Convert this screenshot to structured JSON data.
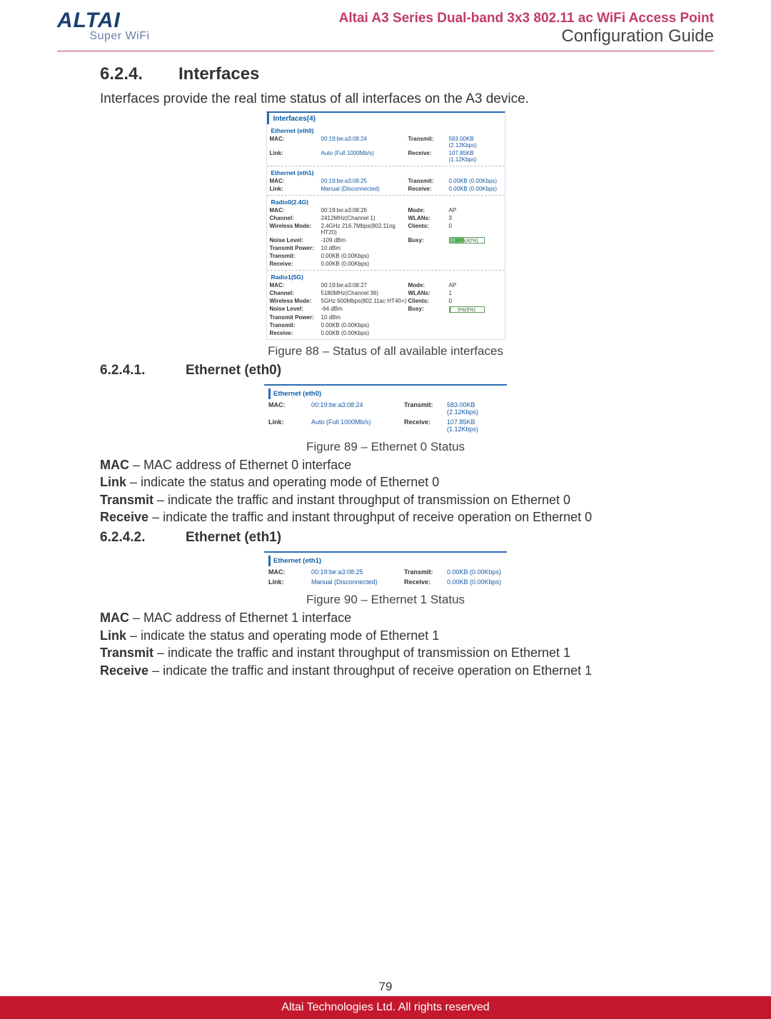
{
  "header": {
    "logo_top": "ALTAI",
    "logo_sub": "Super WiFi",
    "title_line1": "Altai A3 Series Dual-band 3x3 802.11 ac WiFi Access Point",
    "title_line2": "Configuration Guide"
  },
  "section": {
    "num": "6.2.4.",
    "title": "Interfaces",
    "intro": "Interfaces provide the real time status of all interfaces on the A3 device."
  },
  "fig88": {
    "panel_title": "Interfaces(4)",
    "eth0": {
      "title": "Ethernet (eth0)",
      "mac_lbl": "MAC:",
      "mac_val": "00:19:be:a3:08:24",
      "tx_lbl": "Transmit:",
      "tx_val": "583.00KB (2.12Kbps)",
      "link_lbl": "Link:",
      "link_val": "Auto (Full 1000Mb/s)",
      "rx_lbl": "Receive:",
      "rx_val": "107.85KB (1.12Kbps)"
    },
    "eth1": {
      "title": "Ethernet (eth1)",
      "mac_lbl": "MAC:",
      "mac_val": "00:19:be:a3:08:25",
      "tx_lbl": "Transmit:",
      "tx_val": "0.00KB (0.00Kbps)",
      "link_lbl": "Link:",
      "link_val": "Manual (Disconnected)",
      "rx_lbl": "Receive:",
      "rx_val": "0.00KB (0.00Kbps)"
    },
    "radio0": {
      "title": "Radio0(2.4G)",
      "mac_lbl": "MAC:",
      "mac_val": "00:19:be:a3:08:26",
      "mode_lbl": "Mode:",
      "mode_val": "AP",
      "chan_lbl": "Channel:",
      "chan_val": "2412MHz(Channel 1)",
      "wlans_lbl": "WLANs:",
      "wlans_val": "3",
      "wmode_lbl": "Wireless Mode:",
      "wmode_val": "2.4GHz 216.7Mbps(802.11ng HT20)",
      "clients_lbl": "Clients:",
      "clients_val": "0",
      "noise_lbl": "Noise Level:",
      "noise_val": "-109 dBm",
      "busy_lbl": "Busy:",
      "busy_val": "36%(42%)",
      "busy_fill": 42,
      "txpwr_lbl": "Transmit Power:",
      "txpwr_val": "10 dBm",
      "tx_lbl": "Transmit:",
      "tx_val": "0.00KB (0.00Kbps)",
      "rx_lbl": "Receive:",
      "rx_val": "0.00KB (0.00Kbps)"
    },
    "radio1": {
      "title": "Radio1(5G)",
      "mac_lbl": "MAC:",
      "mac_val": "00:19:be:a3:08:27",
      "mode_lbl": "Mode:",
      "mode_val": "AP",
      "chan_lbl": "Channel:",
      "chan_val": "5180MHz(Channel 36)",
      "wlans_lbl": "WLANs:",
      "wlans_val": "1",
      "wmode_lbl": "Wireless Mode:",
      "wmode_val": "5GHz 600Mbps(802.11ac HT40+)",
      "clients_lbl": "Clients:",
      "clients_val": "0",
      "noise_lbl": "Noise Level:",
      "noise_val": "-94 dBm",
      "busy_lbl": "Busy:",
      "busy_val": "5%(5%)",
      "busy_fill": 5,
      "txpwr_lbl": "Transmit Power:",
      "txpwr_val": "10 dBm",
      "tx_lbl": "Transmit:",
      "tx_val": "0.00KB (0.00Kbps)",
      "rx_lbl": "Receive:",
      "rx_val": "0.00KB (0.00Kbps)"
    },
    "caption": "Figure 88 – Status of all available interfaces"
  },
  "sub1": {
    "num": "6.2.4.1.",
    "title": "Ethernet (eth0)",
    "panel": {
      "title": "Ethernet (eth0)",
      "mac_lbl": "MAC:",
      "mac_val": "00:19:be:a3:08:24",
      "tx_lbl": "Transmit:",
      "tx_val": "583.00KB (2.12Kbps)",
      "link_lbl": "Link:",
      "link_val": "Auto (Full 1000Mb/s)",
      "rx_lbl": "Receive:",
      "rx_val": "107.85KB (1.12Kbps)"
    },
    "caption": "Figure 89 – Ethernet 0 Status",
    "desc": {
      "mac": " – MAC address of Ethernet 0 interface",
      "link": " – indicate the status and operating mode of Ethernet 0",
      "tx": " – indicate the traffic and instant throughput of transmission on Ethernet 0",
      "rx": " – indicate the traffic and instant throughput of receive operation on Ethernet 0",
      "b_mac": "MAC",
      "b_link": "Link",
      "b_tx": "Transmit",
      "b_rx": "Receive"
    }
  },
  "sub2": {
    "num": "6.2.4.2.",
    "title": "Ethernet (eth1)",
    "panel": {
      "title": "Ethernet (eth1)",
      "mac_lbl": "MAC:",
      "mac_val": "00:19:be:a3:08:25",
      "tx_lbl": "Transmit:",
      "tx_val": "0.00KB (0.00Kbps)",
      "link_lbl": "Link:",
      "link_val": "Manual (Disconnected)",
      "rx_lbl": "Receive:",
      "rx_val": "0.00KB (0.00Kbps)"
    },
    "caption": "Figure 90 – Ethernet 1 Status",
    "desc": {
      "mac": " – MAC address of Ethernet 1 interface",
      "link": " – indicate the status and operating mode of Ethernet 1",
      "tx": " – indicate the traffic and instant throughput of transmission on Ethernet 1",
      "rx": " – indicate the traffic and instant throughput of receive operation on Ethernet 1",
      "b_mac": "MAC",
      "b_link": "Link",
      "b_tx": "Transmit",
      "b_rx": "Receive"
    }
  },
  "footer": {
    "page_num": "79",
    "copyright": "Altai Technologies Ltd. All rights reserved"
  }
}
